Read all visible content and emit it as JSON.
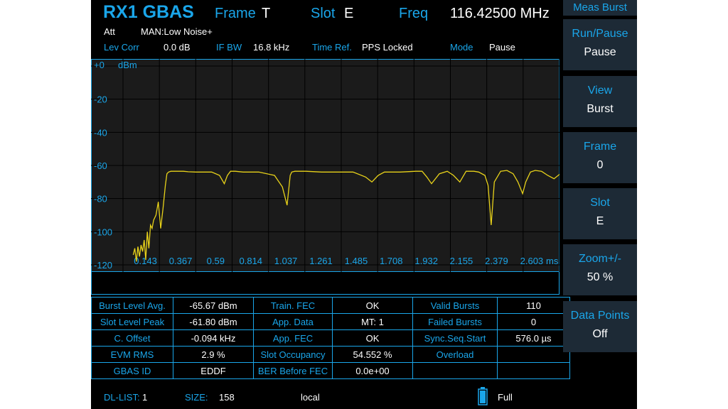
{
  "header": {
    "title": "RX1 GBAS",
    "frame_label": "Frame",
    "frame_value": "T",
    "slot_label": "Slot",
    "slot_value": "E",
    "freq_label": "Freq",
    "freq_value": "116.42500  MHz",
    "att_label": "Att",
    "att_value": "MAN:Low Noise+",
    "lev_corr_label": "Lev Corr",
    "lev_corr_value": "0.0  dB",
    "if_bw_label": "IF BW",
    "if_bw_value": "16.8 kHz",
    "time_ref_label": "Time Ref.",
    "time_ref_value": "PPS Locked",
    "mode_label": "Mode",
    "mode_value": "Pause"
  },
  "chart_data": {
    "type": "line",
    "xlabel": "ms",
    "ylabel": "dBm",
    "xlim": [
      0,
      2.78
    ],
    "ylim": [
      -120,
      0
    ],
    "y_ticks": [
      "+0",
      "-20",
      "-40",
      "-60",
      "-80",
      "-100",
      "-120"
    ],
    "x_ticks": [
      "0.143",
      "0.367",
      "0.59",
      "0.814",
      "1.037",
      "1.261",
      "1.485",
      "1.708",
      "1.932",
      "2.155",
      "2.379",
      "2.603"
    ],
    "grid": true,
    "color": "#e8d21a",
    "series": [
      {
        "x": [
          0.0,
          0.01,
          0.02,
          0.03,
          0.04,
          0.05,
          0.06,
          0.07,
          0.08,
          0.09,
          0.1,
          0.11,
          0.12,
          0.13,
          0.145,
          0.16,
          0.175,
          0.19,
          0.205,
          0.215,
          0.225,
          0.24,
          0.26,
          0.29,
          0.32,
          0.35,
          0.4,
          0.5,
          0.55,
          0.58,
          0.6,
          0.62,
          0.65,
          0.7,
          0.8,
          0.9,
          0.95,
          0.98,
          1.0,
          1.01,
          1.03,
          1.06,
          1.1,
          1.2,
          1.3,
          1.4,
          1.48,
          1.52,
          1.56,
          1.6,
          1.7,
          1.8,
          1.84,
          1.87,
          1.9,
          1.95,
          2.0,
          2.04,
          2.08,
          2.12,
          2.17,
          2.2,
          2.24,
          2.26,
          2.28,
          2.3,
          2.34,
          2.38,
          2.42,
          2.45,
          2.48,
          2.5,
          2.53,
          2.56,
          2.6,
          2.64,
          2.68,
          2.72,
          2.78
        ],
        "y": [
          -114,
          -110,
          -118,
          -109,
          -115,
          -108,
          -112,
          -105,
          -117,
          -100,
          -110,
          -96,
          -98,
          -93,
          -90,
          -82,
          -98,
          -86,
          -72,
          -65,
          -64,
          -63.5,
          -63.5,
          -63.5,
          -63.5,
          -63.8,
          -64,
          -64,
          -66,
          -71,
          -66,
          -63.5,
          -63.5,
          -64,
          -64,
          -66,
          -73,
          -84,
          -66,
          -64,
          -63.5,
          -63.5,
          -63.5,
          -64,
          -64,
          -64,
          -67,
          -70,
          -66,
          -64,
          -64,
          -63.5,
          -63.5,
          -67,
          -71,
          -65,
          -63.5,
          -66,
          -70,
          -63.5,
          -63.5,
          -64,
          -66,
          -72,
          -96,
          -70,
          -63.5,
          -63,
          -65,
          -70,
          -77,
          -70,
          -64,
          -63,
          -63.5,
          -66,
          -68,
          -65,
          -63
        ]
      }
    ]
  },
  "table": {
    "rows": [
      [
        "Burst Level Avg.",
        "-65.67 dBm",
        "Train. FEC",
        "OK",
        "Valid Bursts",
        "110"
      ],
      [
        "Slot Level Peak",
        "-61.80 dBm",
        "App. Data",
        "MT: 1",
        "Failed Bursts",
        "0"
      ],
      [
        "C. Offset",
        "-0.094 kHz",
        "App. FEC",
        "OK",
        "Sync.Seq.Start",
        "576.0 µs"
      ],
      [
        "EVM RMS",
        "2.9 %",
        "Slot Occupancy",
        "54.552 %",
        "Overload",
        ""
      ],
      [
        "GBAS ID",
        "EDDF",
        "BER Before FEC",
        "0.0e+00",
        "",
        ""
      ]
    ]
  },
  "footer": {
    "dl_list_label": "DL-LIST:",
    "dl_list_value": "1",
    "size_label": "SIZE:",
    "size_value": "158",
    "location": "local",
    "battery_label": "Full"
  },
  "softkeys": {
    "title": "Meas Burst",
    "items": [
      {
        "title": "Run/Pause",
        "sub": "Pause"
      },
      {
        "title": "View",
        "sub": "Burst"
      },
      {
        "title": "Frame",
        "sub": "0"
      },
      {
        "title": "Slot",
        "sub": "E"
      },
      {
        "title": "Zoom+/-",
        "sub": "50 %"
      },
      {
        "title": "Data Points",
        "sub": "Off"
      }
    ]
  }
}
